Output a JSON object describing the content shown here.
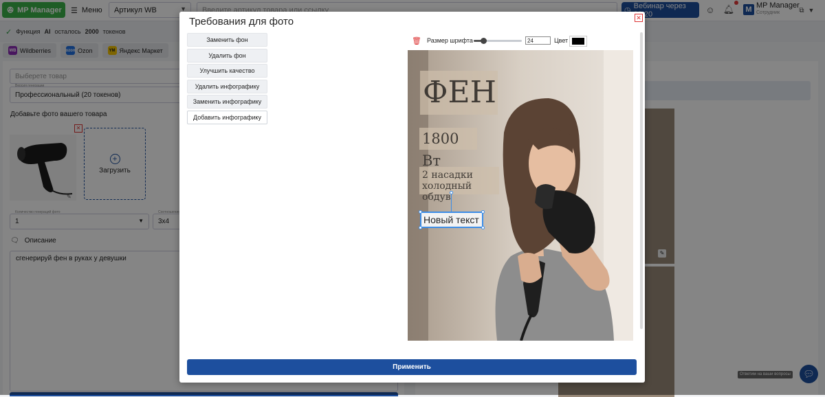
{
  "topbar": {
    "brand": "MP Manager",
    "menu_label": "Меню",
    "article_select": "Артикул WB",
    "search_placeholder": "Введите артикул товара или ссылку",
    "webinar_label": "Вебинар через 20:20",
    "user_initial": "M",
    "user_name": "MP Manager",
    "user_role": "Сотрудник"
  },
  "tokens": {
    "prefix": "Функция",
    "ai": "AI",
    "middle": "осталось",
    "count": "2000",
    "suffix": "токенов"
  },
  "marketplaces": [
    {
      "label": "Wildberries",
      "icon": "WB"
    },
    {
      "label": "Ozon",
      "icon": "ozon"
    },
    {
      "label": "Яндекс Маркет",
      "icon": "YM"
    }
  ],
  "left_panel": {
    "product_placeholder": "Выберете товар",
    "generation_caption": "Версия генерации",
    "generation_value": "Профессиональный (20 токенов)",
    "photo_section_title": "Добавьте фото вашего товара",
    "upload_label": "Загрузить",
    "count_caption": "Количество генераций фото",
    "count_value": "1",
    "ratio_caption": "Соотношение",
    "ratio_value": "3x4",
    "description_title": "Описание",
    "description_value": "сгенерируй фен в руках у девушки"
  },
  "modal": {
    "title": "Требования для фото",
    "actions": [
      {
        "label": "Заменить фон",
        "active": false
      },
      {
        "label": "Удалить фон",
        "active": false
      },
      {
        "label": "Улучшить качество",
        "active": false
      },
      {
        "label": "Удалить инфографику",
        "active": false
      },
      {
        "label": "Заменить инфографику",
        "active": false
      },
      {
        "label": "Добавить инфографику",
        "active": true
      }
    ],
    "toolbar": {
      "font_size_label": "Размер шрифта",
      "font_size_value": "24",
      "font_size_slider_fraction": 0.2,
      "color_label": "Цвет",
      "color_value": "#000000"
    },
    "overlays": {
      "title": "ФЕН",
      "power": "1800 Вт",
      "line1": "2 насадки",
      "line2": "холодный обдув",
      "new_text": "Новый текст"
    },
    "apply_label": "Применить"
  },
  "chat": {
    "tooltip": "Ответим на ваши вопросы"
  },
  "colors": {
    "brand_green": "#3db34a",
    "primary_blue": "#1d4f9e",
    "danger_red": "#d33333"
  }
}
